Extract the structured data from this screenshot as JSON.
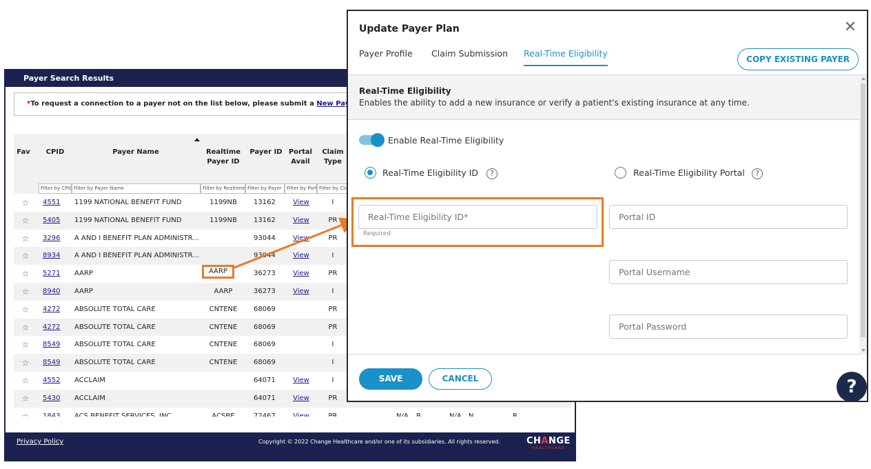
{
  "background_window": {
    "title": "Payer Search Results",
    "notice": {
      "asterisk": "*",
      "text": "To request a connection to a payer not on the list below, please submit a ",
      "link": "New Payer Conne"
    },
    "table": {
      "headers": {
        "fav": "Fav",
        "cpid": "CPID",
        "payer_name": "Payer Name",
        "realtime_payer_id_1": "Realtime",
        "realtime_payer_id_2": "Payer ID",
        "payer_id": "Payer ID",
        "portal_avail_1": "Portal",
        "portal_avail_2": "Avail",
        "claim_type_1": "Claim",
        "claim_type_2": "Type"
      },
      "filters": {
        "cpid": "Filter by CPID",
        "payer_name": "Filter by Payer Name",
        "realtime": "Filter by Realtime",
        "payer_id": "Filter by Payer",
        "portal": "Filter by Portal",
        "claim_type": "Filter by Claim"
      },
      "rows": [
        {
          "fav": "☆",
          "cpid": "4551",
          "name": "1199 NATIONAL BENEFIT FUND",
          "rtid": "1199NB",
          "pid": "13162",
          "portal": "View",
          "ctype": "I"
        },
        {
          "fav": "☆",
          "cpid": "5405",
          "name": "1199 NATIONAL BENEFIT FUND",
          "rtid": "1199NB",
          "pid": "13162",
          "portal": "View",
          "ctype": "PR"
        },
        {
          "fav": "☆",
          "cpid": "3296",
          "name": "A AND I BENEFIT PLAN ADMINISTR...",
          "rtid": "",
          "pid": "93044",
          "portal": "View",
          "ctype": "PR"
        },
        {
          "fav": "☆",
          "cpid": "8934",
          "name": "A AND I BENEFIT PLAN ADMINISTR...",
          "rtid": "",
          "pid": "93044",
          "portal": "View",
          "ctype": "I"
        },
        {
          "fav": "☆",
          "cpid": "5271",
          "name": "AARP",
          "rtid": "",
          "pid": "36273",
          "portal": "View",
          "ctype": "PR"
        },
        {
          "fav": "☆",
          "cpid": "8940",
          "name": "AARP",
          "rtid": "AARP",
          "pid": "36273",
          "portal": "View",
          "ctype": "I"
        },
        {
          "fav": "☆",
          "cpid": "4272",
          "name": "ABSOLUTE TOTAL CARE",
          "rtid": "CNTENE",
          "pid": "68069",
          "portal": "",
          "ctype": "PR"
        },
        {
          "fav": "☆",
          "cpid": "4272",
          "name": "ABSOLUTE TOTAL CARE",
          "rtid": "CNTENE",
          "pid": "68069",
          "portal": "",
          "ctype": "PR"
        },
        {
          "fav": "☆",
          "cpid": "8549",
          "name": "ABSOLUTE TOTAL CARE",
          "rtid": "CNTENE",
          "pid": "68069",
          "portal": "",
          "ctype": "I"
        },
        {
          "fav": "☆",
          "cpid": "8549",
          "name": "ABSOLUTE TOTAL CARE",
          "rtid": "CNTENE",
          "pid": "68069",
          "portal": "",
          "ctype": "I"
        },
        {
          "fav": "☆",
          "cpid": "4552",
          "name": "ACCLAIM",
          "rtid": "",
          "pid": "64071",
          "portal": "View",
          "ctype": "I"
        },
        {
          "fav": "☆",
          "cpid": "5430",
          "name": "ACCLAIM",
          "rtid": "",
          "pid": "64071",
          "portal": "View",
          "ctype": "PR"
        },
        {
          "fav": "☆",
          "cpid": "1843",
          "name": "ACS BENEFIT SERVICES, INC",
          "rtid": "ACSBE",
          "pid": "72467",
          "portal": "View",
          "ctype": "PR"
        }
      ],
      "partial_row_extra": {
        "a": "N/A",
        "b": "B",
        "c": "N/A",
        "d": "N",
        "e": "R"
      }
    },
    "highlighted_value": "AARP",
    "footer": {
      "privacy": "Privacy Policy",
      "copyright": "Copyright © 2022 Change Healthcare and/or one of its subsidiaries. All rights reserved.",
      "logo_main_1": "CH",
      "logo_main_accent": "A",
      "logo_main_2": "NGE",
      "logo_sub": "HEALTHCARE"
    }
  },
  "modal": {
    "title": "Update Payer Plan",
    "close_icon": "✕",
    "tabs": [
      {
        "label": "Payer Profile",
        "active": false
      },
      {
        "label": "Claim Submission",
        "active": false
      },
      {
        "label": "Real-Time Eligibility",
        "active": true
      }
    ],
    "copy_button": "COPY EXISTING PAYER",
    "section": {
      "title": "Real-Time Eligibility",
      "description": "Enables the ability to add a new insurance or verify a patient's existing insurance at any time."
    },
    "toggle": {
      "label": "Enable Real-Time Eligibility",
      "enabled": true
    },
    "radios": [
      {
        "label": "Real-Time Eligibility ID",
        "checked": true
      },
      {
        "label": "Real-Time Eligibility Portal",
        "checked": false
      }
    ],
    "help_glyph": "?",
    "fields": {
      "rte_id": {
        "placeholder": "Real-Time Eligibility ID*",
        "value": "",
        "hint": "Required"
      },
      "portal_id": {
        "placeholder": "Portal ID",
        "value": ""
      },
      "portal_username": {
        "placeholder": "Portal Username",
        "value": ""
      },
      "portal_password": {
        "placeholder": "Portal Password",
        "value": ""
      }
    },
    "save_button": "SAVE",
    "cancel_button": "CANCEL",
    "help_fab": "?"
  },
  "colors": {
    "accent_blue": "#1a90c8",
    "navy": "#1b2250",
    "annotation_orange": "#ea7a24",
    "link_blue": "#1a1a8c"
  }
}
